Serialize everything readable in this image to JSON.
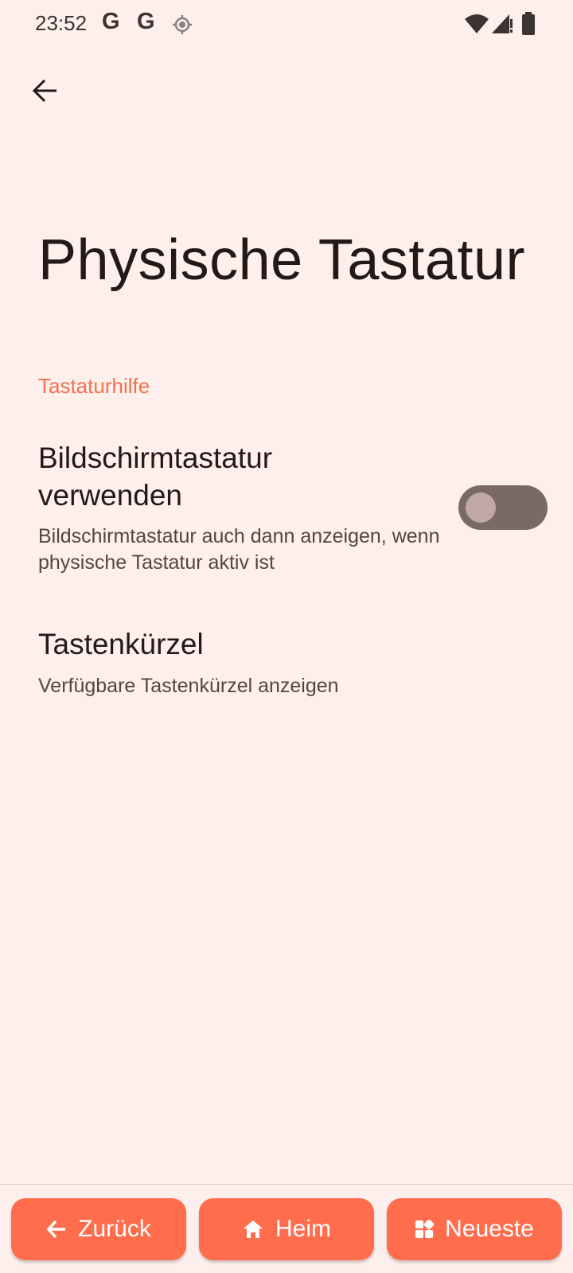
{
  "status_bar": {
    "time": "23:52",
    "notification_icons": [
      "google-g-icon",
      "google-g-icon",
      "location-icon"
    ],
    "google_letter": "G",
    "system_icons": [
      "wifi-icon",
      "signal-icon",
      "battery-icon"
    ]
  },
  "header": {
    "back_icon": "arrow-back-icon",
    "title": "Physische Tastatur"
  },
  "section": {
    "header": "Tastaturhilfe",
    "items": [
      {
        "title": "Bildschirmtastatur verwenden",
        "summary": "Bildschirmtastatur auch dann anzeigen, wenn physische Tastatur aktiv ist",
        "toggle_on": false
      },
      {
        "title": "Tastenkürzel",
        "summary": "Verfügbare Tastenkürzel anzeigen"
      }
    ]
  },
  "nav_bar": {
    "back_label": "Zurück",
    "home_label": "Heim",
    "recents_label": "Neueste"
  },
  "colors": {
    "background": "#fcefec",
    "accent": "#f2714f",
    "nav_button": "#ff6d4d",
    "toggle_track_off": "#7a6a66"
  }
}
